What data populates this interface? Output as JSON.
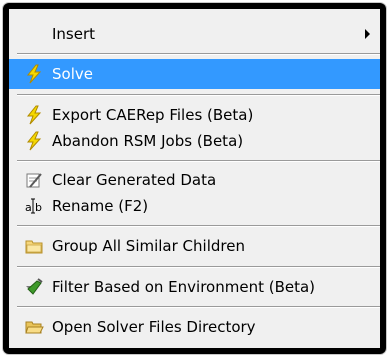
{
  "menu": {
    "items": [
      {
        "label": "Insert",
        "icon": "none",
        "has_submenu": true
      },
      {
        "label": "Solve",
        "icon": "lightning-icon",
        "selected": true
      },
      {
        "label": "Export CAERep Files (Beta)",
        "icon": "lightning-icon"
      },
      {
        "label": "Abandon RSM Jobs (Beta)",
        "icon": "lightning-icon"
      },
      {
        "label": "Clear Generated Data",
        "icon": "clear-data-icon"
      },
      {
        "label": "Rename (F2)",
        "icon": "rename-icon"
      },
      {
        "label": "Group All Similar Children",
        "icon": "folder-icon"
      },
      {
        "label": "Filter Based on Environment (Beta)",
        "icon": "filter-icon"
      },
      {
        "label": "Open Solver Files Directory",
        "icon": "open-folder-icon"
      }
    ]
  },
  "colors": {
    "selection": "#3399ff",
    "menu_background": "#f0f0f0",
    "bolt_fill": "#f5d800"
  }
}
